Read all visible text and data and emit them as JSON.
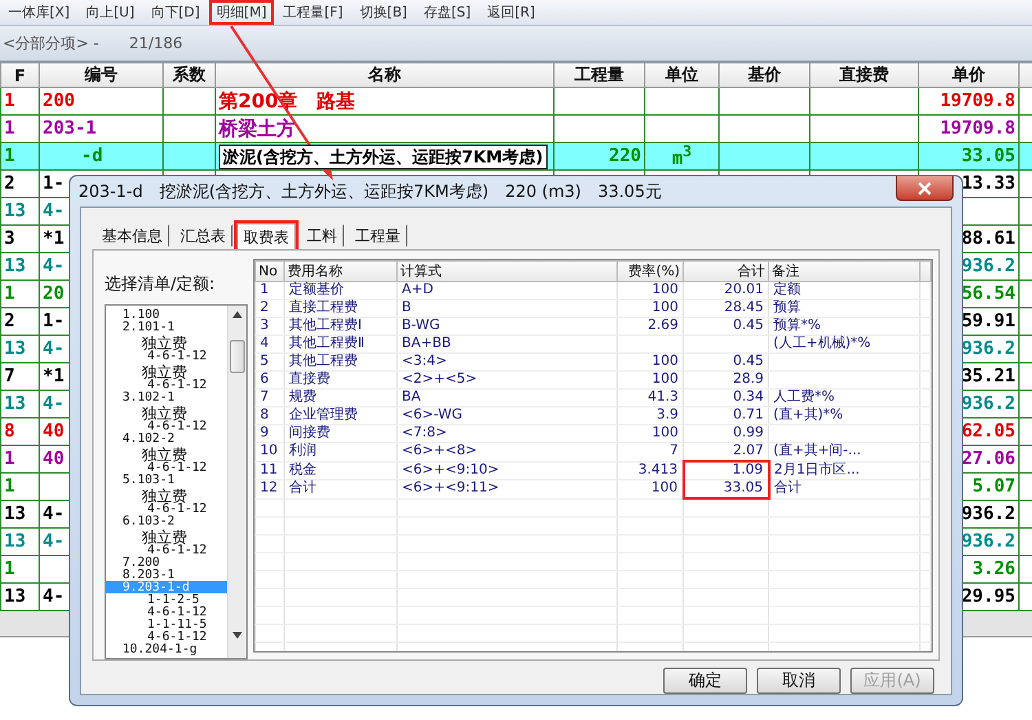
{
  "menu": [
    {
      "label": "一体库[X]",
      "highlighted": false
    },
    {
      "label": "向上[U]",
      "highlighted": false
    },
    {
      "label": "向下[D]",
      "highlighted": false
    },
    {
      "label": "明细[M]",
      "highlighted": true
    },
    {
      "label": "工程量[F]",
      "highlighted": false
    },
    {
      "label": "切换[B]",
      "highlighted": false
    },
    {
      "label": "存盘[S]",
      "highlighted": false
    },
    {
      "label": "返回[R]",
      "highlighted": false
    }
  ],
  "info": {
    "section": "<分部分项> -",
    "counter": "21/186"
  },
  "table": {
    "columns": [
      "F",
      "编号",
      "系数",
      "名称",
      "工程量",
      "单位",
      "基价",
      "直接费",
      "单价"
    ],
    "rows": [
      {
        "f": "1",
        "code": "200",
        "name": "第200章　路基",
        "price": "19709.8",
        "color": "#e00000",
        "selected": false
      },
      {
        "f": "1",
        "code": "203-1",
        "name": "桥梁土方",
        "price": "19709.8",
        "color": "#a000a0",
        "selected": false
      },
      {
        "f": "1",
        "code": "-d",
        "name": "淤泥(含挖方、土方外运、运距按7KM考虑)",
        "qty": "220",
        "unit": "m$^{3}$",
        "price": "33.05",
        "color": "#009000",
        "selected": true
      },
      {
        "f": "2",
        "code": "1-",
        "price": "13.33",
        "color": "#000000",
        "selected": false
      },
      {
        "f": "13",
        "code": "4-",
        "color": "#008b8b",
        "selected": false
      },
      {
        "f": "3",
        "code": "*1",
        "price": "88.61",
        "color": "#000000",
        "selected": false
      },
      {
        "f": "13",
        "code": "4-",
        "price": "936.2",
        "color": "#008b8b",
        "selected": false
      },
      {
        "f": "1",
        "code": "20",
        "price": "56.54",
        "color": "#009000",
        "selected": false
      },
      {
        "f": "2",
        "code": "1-",
        "price": "59.91",
        "color": "#000000",
        "selected": false
      },
      {
        "f": "13",
        "code": "4-",
        "price": "936.2",
        "color": "#008b8b",
        "selected": false
      },
      {
        "f": "7",
        "code": "*1",
        "price": "35.21",
        "color": "#000000",
        "selected": false
      },
      {
        "f": "13",
        "code": "4-",
        "price": "936.2",
        "color": "#008b8b",
        "selected": false
      },
      {
        "f": "8",
        "code": "40",
        "price": "62.05",
        "color": "#e00000",
        "selected": false
      },
      {
        "f": "1",
        "code": "40",
        "price": "27.06",
        "color": "#a000a0",
        "selected": false
      },
      {
        "f": "1",
        "price": "5.07",
        "color": "#009000",
        "selected": false
      },
      {
        "f": "13",
        "code": "4-",
        "price": "936.2",
        "color": "#000000",
        "selected": false
      },
      {
        "f": "13",
        "code": "4-",
        "price": "936.2",
        "color": "#008b8b",
        "selected": false
      },
      {
        "f": "1",
        "price": "3.26",
        "color": "#009000",
        "selected": false
      },
      {
        "f": "13",
        "code": "4-",
        "price": "29.95",
        "color": "#000000",
        "selected": false
      }
    ]
  },
  "dialog": {
    "title": {
      "code": "203-1-d",
      "name": "挖淤泥(含挖方、土方外运、运距按7KM考虑)",
      "qty": "220 (m3)",
      "total": "33.05元"
    },
    "tabs": [
      {
        "label": "基本信息",
        "selected": false,
        "highlighted": false
      },
      {
        "label": "汇总表",
        "selected": false,
        "highlighted": false
      },
      {
        "label": "取费表",
        "selected": true,
        "highlighted": true
      },
      {
        "label": "工料",
        "selected": false,
        "highlighted": false
      },
      {
        "label": "工程量",
        "selected": false,
        "highlighted": false
      }
    ],
    "list_label": "选择清单/定额:",
    "tree": [
      {
        "label": "1.100",
        "kind": "item",
        "selected": false
      },
      {
        "label": "2.101-1",
        "kind": "item",
        "selected": false,
        "children": [
          {
            "label": "独立费",
            "kind": "fee",
            "selected": false
          },
          {
            "label": "4-6-1-12",
            "kind": "code",
            "selected": false
          },
          {
            "label": "独立费",
            "kind": "fee",
            "selected": false
          },
          {
            "label": "4-6-1-12",
            "kind": "code",
            "selected": false
          }
        ]
      },
      {
        "label": "3.102-1",
        "kind": "item",
        "selected": false,
        "children": [
          {
            "label": "独立费",
            "kind": "fee",
            "selected": false
          },
          {
            "label": "4-6-1-12",
            "kind": "code",
            "selected": false
          }
        ]
      },
      {
        "label": "4.102-2",
        "kind": "item",
        "selected": false,
        "children": [
          {
            "label": "独立费",
            "kind": "fee",
            "selected": false
          },
          {
            "label": "4-6-1-12",
            "kind": "code",
            "selected": false
          }
        ]
      },
      {
        "label": "5.103-1",
        "kind": "item",
        "selected": false,
        "children": [
          {
            "label": "独立费",
            "kind": "fee",
            "selected": false
          },
          {
            "label": "4-6-1-12",
            "kind": "code",
            "selected": false
          }
        ]
      },
      {
        "label": "6.103-2",
        "kind": "item",
        "selected": false,
        "children": [
          {
            "label": "独立费",
            "kind": "fee",
            "selected": false
          },
          {
            "label": "4-6-1-12",
            "kind": "code",
            "selected": false
          }
        ]
      },
      {
        "label": "7.200",
        "kind": "item",
        "selected": false
      },
      {
        "label": "8.203-1",
        "kind": "item",
        "selected": false
      },
      {
        "label": "9.203-1-d",
        "kind": "item",
        "selected": true,
        "children": [
          {
            "label": "1-1-2-5",
            "kind": "code",
            "selected": false
          },
          {
            "label": "4-6-1-12",
            "kind": "code",
            "selected": false
          },
          {
            "label": "1-1-11-5",
            "kind": "code",
            "selected": false
          },
          {
            "label": "4-6-1-12",
            "kind": "code",
            "selected": false
          }
        ]
      },
      {
        "label": "10.204-1-g",
        "kind": "item",
        "selected": false
      }
    ],
    "fee_table": {
      "columns": [
        "No",
        "费用名称",
        "计算式",
        "费率(%)",
        "合计",
        "备注"
      ],
      "rows": [
        {
          "no": "1",
          "name": "定额基价",
          "formula": "A+D",
          "rate": "100",
          "total": "20.01",
          "note": "定额",
          "total_highlighted": false
        },
        {
          "no": "2",
          "name": "直接工程费",
          "formula": "B",
          "rate": "100",
          "total": "28.45",
          "note": "预算",
          "total_highlighted": false
        },
        {
          "no": "3",
          "name": "其他工程费Ⅰ",
          "formula": "B-WG",
          "rate": "2.69",
          "total": "0.45",
          "note": "预算*%",
          "total_highlighted": false
        },
        {
          "no": "4",
          "name": "其他工程费Ⅱ",
          "formula": "BA+BB",
          "note": "(人工+机械)*%",
          "total_highlighted": false
        },
        {
          "no": "5",
          "name": "其他工程费",
          "formula": "<3:4>",
          "rate": "100",
          "total": "0.45",
          "total_highlighted": false
        },
        {
          "no": "6",
          "name": "直接费",
          "formula": "<2>+<5>",
          "rate": "100",
          "total": "28.9",
          "total_highlighted": false
        },
        {
          "no": "7",
          "name": "规费",
          "formula": "BA",
          "rate": "41.3",
          "total": "0.34",
          "note": "人工费*%",
          "total_highlighted": false
        },
        {
          "no": "8",
          "name": "企业管理费",
          "formula": "<6>-WG",
          "rate": "3.9",
          "total": "0.71",
          "note": "(直+其)*%",
          "total_highlighted": false
        },
        {
          "no": "9",
          "name": "间接费",
          "formula": "<7:8>",
          "rate": "100",
          "total": "0.99",
          "total_highlighted": false
        },
        {
          "no": "10",
          "name": "利润",
          "formula": "<6>+<8>",
          "rate": "7",
          "total": "2.07",
          "note": "(直+其+间-...",
          "total_highlighted": false
        },
        {
          "no": "11",
          "name": "税金",
          "formula": "<6>+<9:10>",
          "rate": "3.413",
          "total": "1.09",
          "note": "2月1日市区...",
          "total_highlighted": true
        },
        {
          "no": "12",
          "name": "合计",
          "formula": "<6>+<9:11>",
          "rate": "100",
          "total": "33.05",
          "note": "合计",
          "total_highlighted": true
        }
      ]
    },
    "buttons": [
      {
        "label": "确定",
        "disabled": false
      },
      {
        "label": "取消",
        "disabled": false
      },
      {
        "label": "应用(A)",
        "disabled": true
      }
    ]
  }
}
